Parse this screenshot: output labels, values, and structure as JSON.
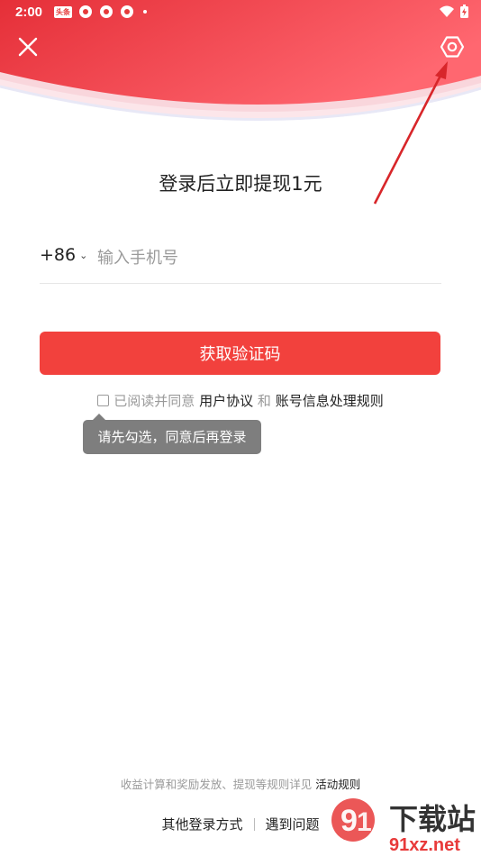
{
  "status_bar": {
    "time": "2:00",
    "badge": "头条"
  },
  "header": {
    "close_icon": "close-icon",
    "settings_icon": "settings-hexagon-icon",
    "gradient_from": "#e8303a",
    "gradient_to": "#ff6a73"
  },
  "title": "登录后立即提现1元",
  "phone": {
    "country_code": "+86",
    "placeholder": "输入手机号",
    "value": ""
  },
  "code_button": {
    "label": "获取验证码",
    "color": "#f2413d"
  },
  "agreement": {
    "prefix": "已阅读并同意",
    "link1": "用户协议",
    "conj": "和",
    "link2": "账号信息处理规则"
  },
  "tooltip": "请先勾选，同意后再登录",
  "rules": {
    "text": "收益计算和奖励发放、提现等规则详见",
    "link": "活动规则"
  },
  "bottom_links": {
    "other_login": "其他登录方式",
    "problem": "遇到问题"
  },
  "watermark": {
    "big": "下载站",
    "url": "91xz.net"
  }
}
